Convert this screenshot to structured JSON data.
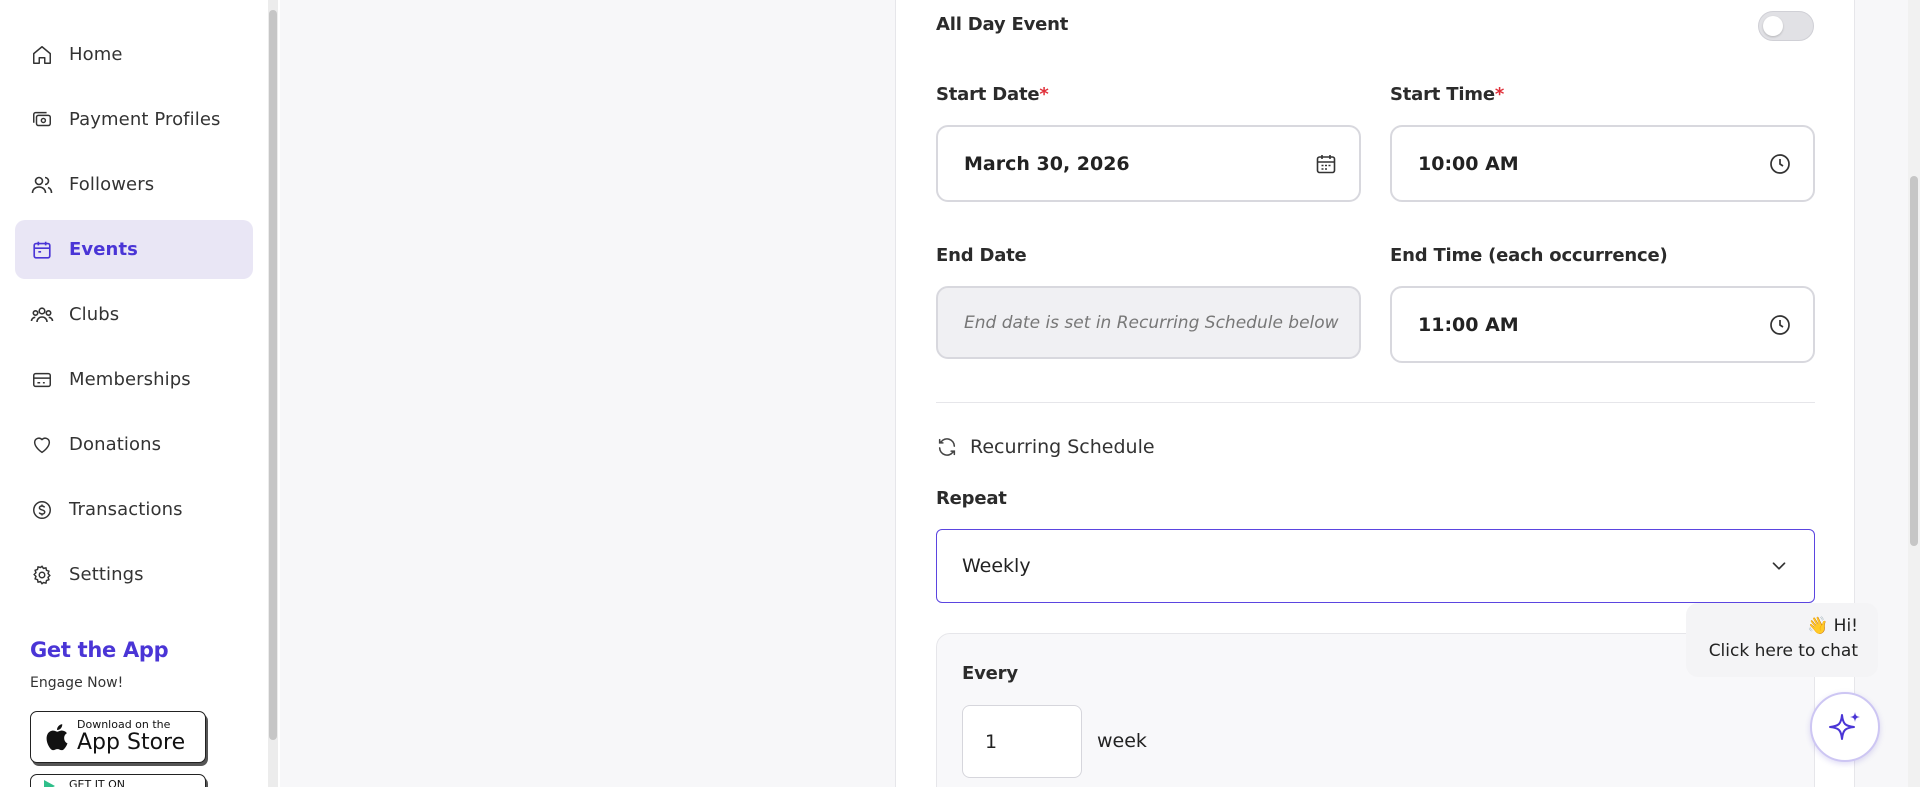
{
  "sidebar": {
    "items": [
      {
        "label": "Home",
        "icon": "home-icon"
      },
      {
        "label": "Payment Profiles",
        "icon": "payment-profile-icon"
      },
      {
        "label": "Followers",
        "icon": "users-icon"
      },
      {
        "label": "Events",
        "icon": "calendar-icon",
        "active": true
      },
      {
        "label": "Clubs",
        "icon": "group-icon"
      },
      {
        "label": "Memberships",
        "icon": "card-icon"
      },
      {
        "label": "Donations",
        "icon": "heart-icon"
      },
      {
        "label": "Transactions",
        "icon": "dollar-circle-icon"
      },
      {
        "label": "Settings",
        "icon": "gear-icon"
      }
    ],
    "get_app": {
      "title": "Get the App",
      "subtitle": "Engage Now!",
      "app_store_small": "Download on the",
      "app_store_big": "App Store",
      "play_small": "GET IT ON"
    }
  },
  "form": {
    "all_day": {
      "label": "All Day Event",
      "on": false
    },
    "start_date": {
      "label": "Start Date",
      "required_mark": "*",
      "value": "March 30, 2026"
    },
    "start_time": {
      "label": "Start Time",
      "required_mark": "*",
      "value": "10:00 AM"
    },
    "end_date": {
      "label": "End Date",
      "placeholder": "End date is set in Recurring Schedule below"
    },
    "end_time": {
      "label": "End Time (each occurrence)",
      "value": "11:00 AM"
    },
    "recurring": {
      "heading": "Recurring Schedule"
    },
    "repeat": {
      "label": "Repeat",
      "value": "Weekly"
    },
    "every": {
      "label": "Every",
      "value": "1",
      "unit": "week"
    }
  },
  "chat": {
    "greeting": "👋 Hi!",
    "cta": "Click here to chat"
  },
  "colors": {
    "accent": "#4a35d6",
    "required": "#e0303a",
    "active_bg": "#e9e6f5"
  }
}
